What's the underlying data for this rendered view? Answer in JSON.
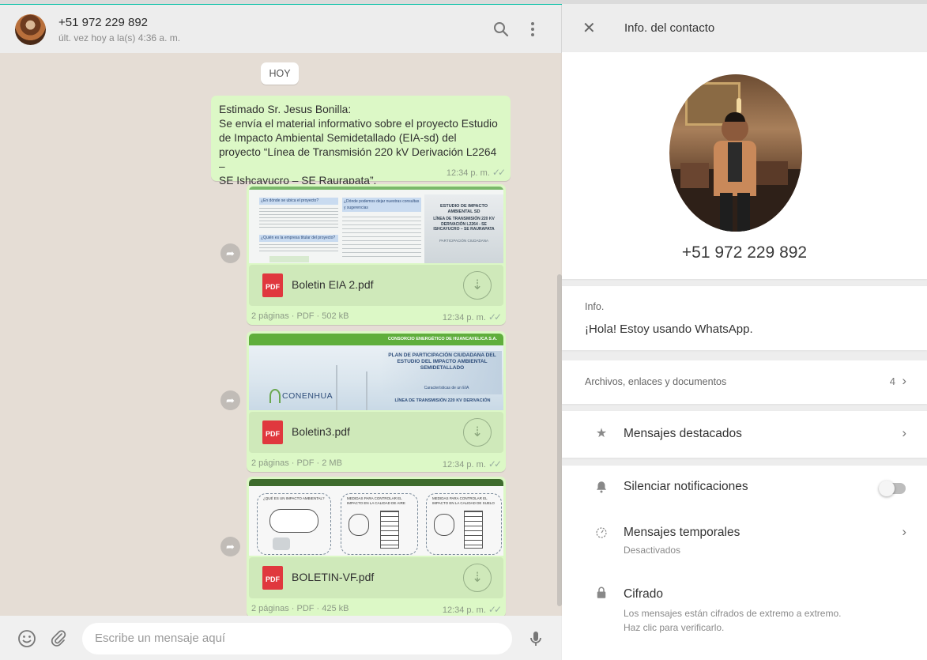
{
  "chat": {
    "contact_phone": "+51 972 229 892",
    "last_seen": "últ. vez hoy a la(s) 4:36 a. m.",
    "day_label": "HOY",
    "text_message": {
      "lines": [
        "Estimado Sr. Jesus Bonilla:",
        "Se envía el material informativo sobre el proyecto Estudio",
        "de Impacto Ambiental Semidetallado (EIA-sd) del",
        "proyecto “Línea de Transmisión 220 kV Derivación L2264 –",
        "SE Ishcayucro – SE Raurapata”."
      ],
      "time": "12:34 p. m."
    },
    "documents": [
      {
        "file_name": "Boletin EIA 2.pdf",
        "meta": "2 páginas · PDF · 502 kB",
        "time": "12:34 p. m.",
        "icon": "pdf-icon",
        "thumb": {
          "q1": "¿En dónde se ubica el proyecto?",
          "q2": "¿Dónde podemos dejar nuestras consultas y sugerencias",
          "q3": "¿Quién es la empresa titular del proyecto?",
          "t1": "ESTUDIO DE IMPACTO AMBIENTAL SD",
          "t2": "LÍNEA DE TRANSMISIÓN 220 KV DERIVACIÓN L2264 - SE ISHCAYUCRO – SE RAURAPATA",
          "t3": "PARTICIPACIÓN CIUDADANA"
        }
      },
      {
        "file_name": "Boletin3.pdf",
        "meta": "2 páginas · PDF · 2 MB",
        "time": "12:34 p. m.",
        "icon": "pdf-icon",
        "thumb": {
          "header": "CONSORCIO ENERGÉTICO DE HUANCAVELICA S.A.",
          "title": "PLAN DE PARTICIPACIÓN CIUDADANA DEL ESTUDIO DEL IMPACTO AMBIENTAL SEMIDETALLADO",
          "sub": "Características de un EIA",
          "line": "LÍNEA DE TRANSMISIÓN 220 KV DERIVACIÓN",
          "logo": "CONENHUA"
        }
      },
      {
        "file_name": "BOLETIN-VF.pdf",
        "meta": "2 páginas · PDF · 425 kB",
        "time": "12:34 p. m.",
        "icon": "pdf-icon",
        "thumb": {
          "c1": "¿QUÉ ES UN IMPACTO AMBIENTAL?",
          "c2": "MEDIDAS PARA CONTROLAR EL IMPACTO EN LA CALIDAD DE AIRE",
          "c3": "MEDIDAS PARA CONTROLAR EL IMPACTO EN LA CALIDAD DE SUELO"
        }
      }
    ],
    "composer_placeholder": "Escribe un mensaje aquí",
    "icons": {
      "search": "search-icon",
      "menu": "menu-icon",
      "emoji": "emoji-icon",
      "attach": "attach-icon",
      "mic": "mic-icon",
      "forward": "forward-icon",
      "download": "download-icon"
    },
    "colors": {
      "outgoing_bubble": "#dcf8c6",
      "chat_bg": "#e5ddd5",
      "pdf_red": "#e0383e"
    }
  },
  "info_panel": {
    "title": "Info. del contacto",
    "phone": "+51 972 229 892",
    "about_label": "Info.",
    "about_value": "¡Hola! Estoy usando WhatsApp.",
    "media_label": "Archivos, enlaces y documentos",
    "media_count": "4",
    "starred_label": "Mensajes destacados",
    "mute_label": "Silenciar notificaciones",
    "mute_enabled": false,
    "disappearing_label": "Mensajes temporales",
    "disappearing_value": "Desactivados",
    "encryption_label": "Cifrado",
    "encryption_line1": "Los mensajes están cifrados de extremo a extremo.",
    "encryption_line2": "Haz clic para verificarlo."
  }
}
